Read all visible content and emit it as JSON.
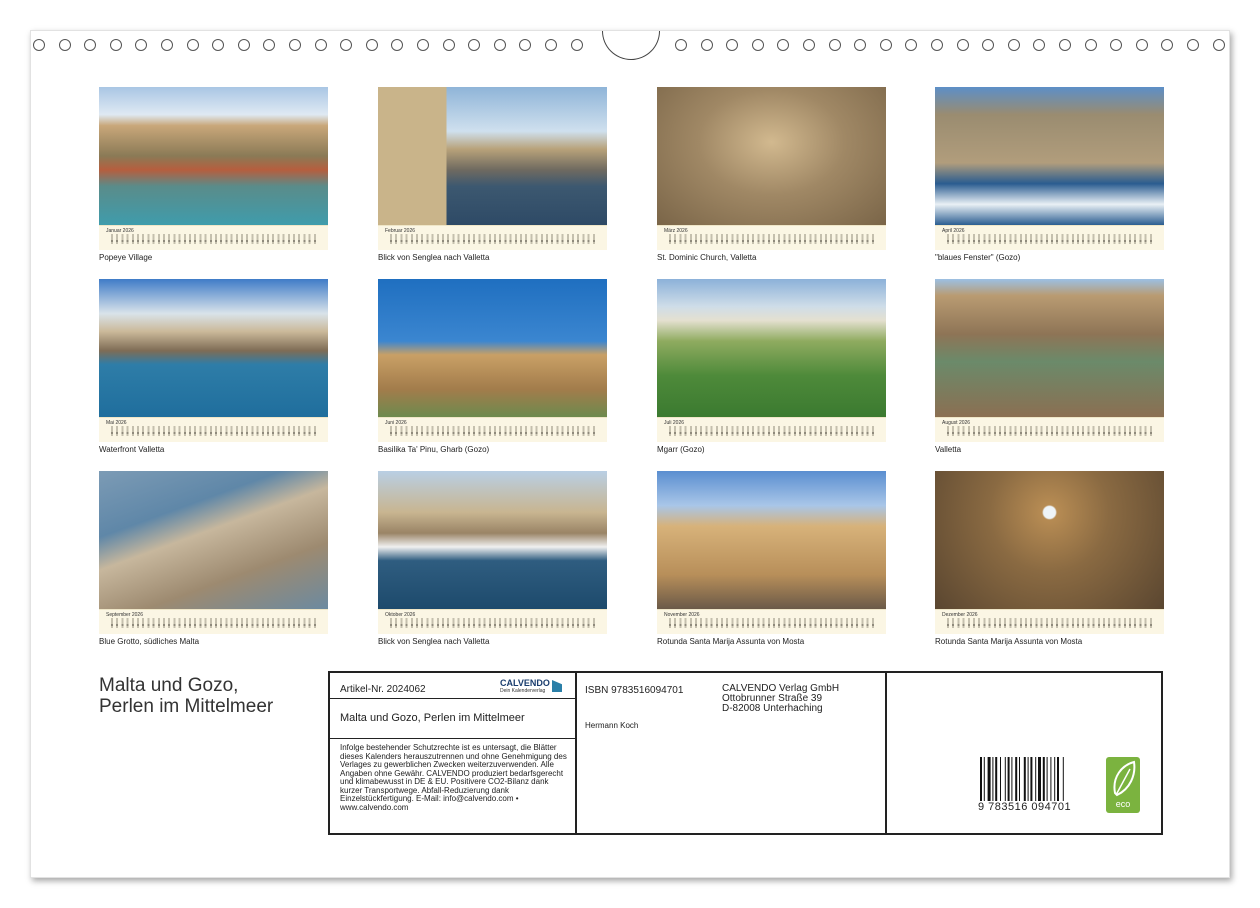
{
  "calendar": {
    "title_line1": "Malta und Gozo,",
    "title_line2": "Perlen im Mittelmeer",
    "months": [
      {
        "month": "Januar",
        "year": "2026",
        "caption": "Popeye Village"
      },
      {
        "month": "Februar",
        "year": "2026",
        "caption": "Blick von Senglea nach Valletta"
      },
      {
        "month": "März",
        "year": "2026",
        "caption": "St. Dominic Church, Valletta"
      },
      {
        "month": "April",
        "year": "2026",
        "caption": "\"blaues Fenster\" (Gozo)"
      },
      {
        "month": "Mai",
        "year": "2026",
        "caption": "Waterfront Valletta"
      },
      {
        "month": "Juni",
        "year": "2026",
        "caption": "Basilika Ta' Pinu, Gharb (Gozo)"
      },
      {
        "month": "Juli",
        "year": "2026",
        "caption": "Mgarr (Gozo)"
      },
      {
        "month": "August",
        "year": "2026",
        "caption": "Valletta"
      },
      {
        "month": "September",
        "year": "2026",
        "caption": "Blue Grotto, südliches Malta"
      },
      {
        "month": "Oktober",
        "year": "2026",
        "caption": "Blick von Senglea nach Valletta"
      },
      {
        "month": "November",
        "year": "2026",
        "caption": "Rotunda Santa Marija Assunta von Mosta"
      },
      {
        "month": "Dezember",
        "year": "2026",
        "caption": "Rotunda Santa Marija Assunta von Mosta"
      }
    ]
  },
  "info": {
    "article": "Artikel-Nr. 2024062",
    "brand": "CALVENDO",
    "brand_sub": "Dein Kalenderverlag",
    "product_title": "Malta und Gozo, Perlen im Mittelmeer",
    "legal": "Infolge bestehender Schutzrechte ist es untersagt, die Blätter dieses Kalenders herauszutrennen und ohne Genehmigung des Verlages zu gewerblichen Zwecken weiterzuverwenden. Alle Angaben ohne Gewähr. CALVENDO produziert bedarfsgerecht und klimabewusst in DE & EU. Positivere CO2-Bilanz dank kurzer Transportwege. Abfall-Reduzierung dank Einzelstückfertigung. E-Mail: info@calvendo.com • www.calvendo.com",
    "isbn": "ISBN 9783516094701",
    "author": "Hermann Koch",
    "publisher_name": "CALVENDO Verlag GmbH",
    "publisher_street": "Ottobrunner Straße 39",
    "publisher_city": "D-82008 Unterhaching",
    "barcode_number": "9 783516 094701",
    "eco_label": "eco"
  },
  "colors": {
    "calendar_strip": "#fbf6e4",
    "eco_green": "#7bb33f",
    "brand_blue": "#1a3d6e"
  }
}
